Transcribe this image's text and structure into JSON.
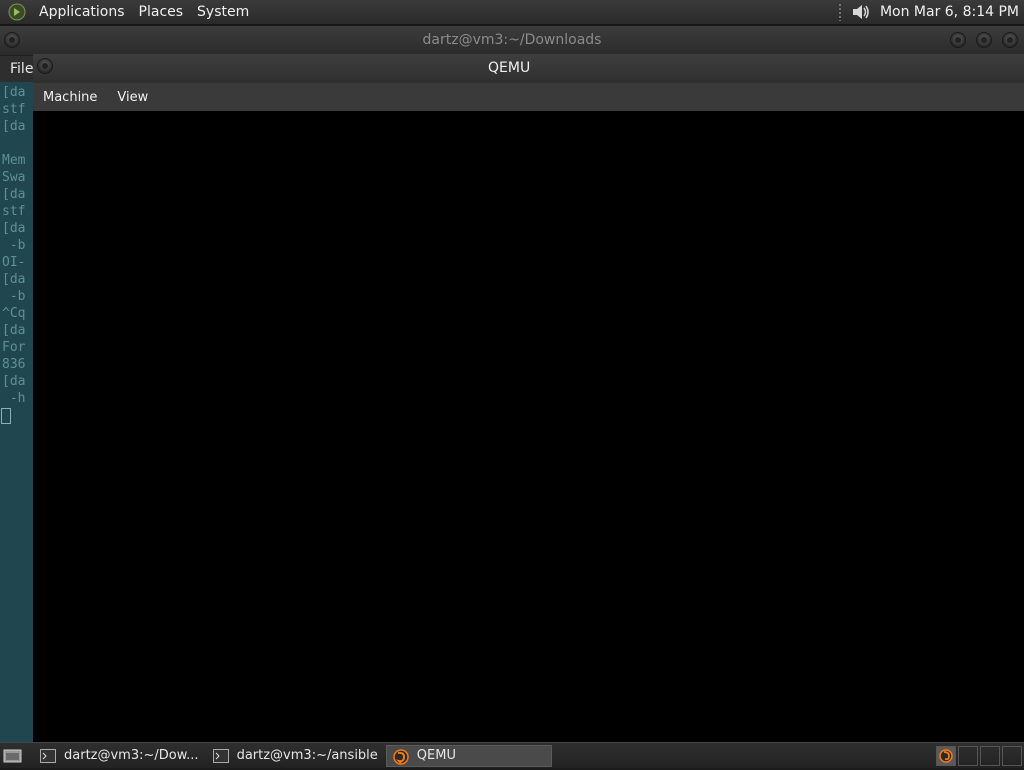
{
  "top_panel": {
    "menus": [
      "Applications",
      "Places",
      "System"
    ],
    "clock": "Mon Mar  6,  8:14 PM",
    "logo_icon": "gnome-foot-icon",
    "volume_icon": "speaker-icon"
  },
  "terminal": {
    "title": "dartz@vm3:~/Downloads",
    "menu_file": "File",
    "lines": [
      "[da",
      "stf",
      "[da",
      "",
      "Mem",
      "Swa",
      "[da",
      "stf",
      "[da",
      " -b",
      "OI-",
      "[da",
      " -b",
      "^Cq",
      "[da",
      "For",
      "836",
      "[da",
      " -h"
    ]
  },
  "qemu": {
    "title": "QEMU",
    "menus": [
      "Machine",
      "View"
    ]
  },
  "taskbar": {
    "tasks": [
      {
        "label": "dartz@vm3:~/Dow...",
        "icon": "terminal-icon"
      },
      {
        "label": "dartz@vm3:~/ansible",
        "icon": "terminal-icon"
      },
      {
        "label": "QEMU",
        "icon": "qemu-icon"
      }
    ]
  },
  "colors": {
    "terminal_bg": "#20474f",
    "terminal_text": "#5f8f98",
    "qemu_screen": "#000000",
    "qemu_accent": "#f57a10"
  }
}
